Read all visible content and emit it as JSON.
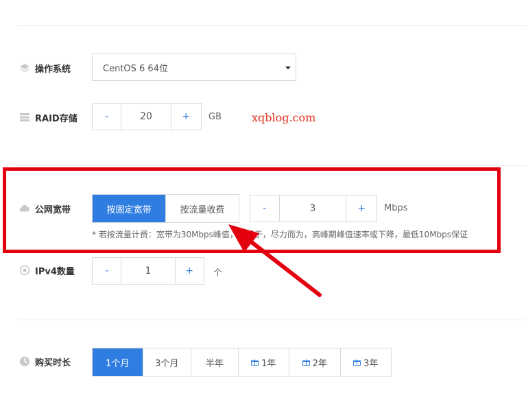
{
  "os": {
    "label": "操作系统",
    "selected": "CentOS 6 64位",
    "icon": "layers-icon"
  },
  "raid": {
    "label": "RAID存储",
    "minus": "-",
    "value": "20",
    "plus": "+",
    "unit": "GB",
    "icon": "storage-icon"
  },
  "watermark": "xqblog.com",
  "bandwidth": {
    "label": "公网宽带",
    "icon": "cloud-icon",
    "options": [
      "按固定宽带",
      "按流量收费"
    ],
    "minus": "-",
    "value": "3",
    "plus": "+",
    "unit": "Mbps",
    "note": "* 若按流量计费：宽带为30Mbps峰值，不限于，尽力而为，高峰期峰值速率或下降，最低10Mbps保证"
  },
  "ipv4": {
    "label": "IPv4数量",
    "icon": "target-icon",
    "minus": "-",
    "value": "1",
    "plus": "+",
    "unit": "个"
  },
  "duration": {
    "label": "购买时长",
    "icon": "clock-icon",
    "options": [
      "1个月",
      "3个月",
      "半年",
      "1年",
      "2年",
      "3年"
    ]
  },
  "colors": {
    "accent": "#2f7de1",
    "highlight_box": "#e3000f",
    "arrow": "#e3000f"
  }
}
